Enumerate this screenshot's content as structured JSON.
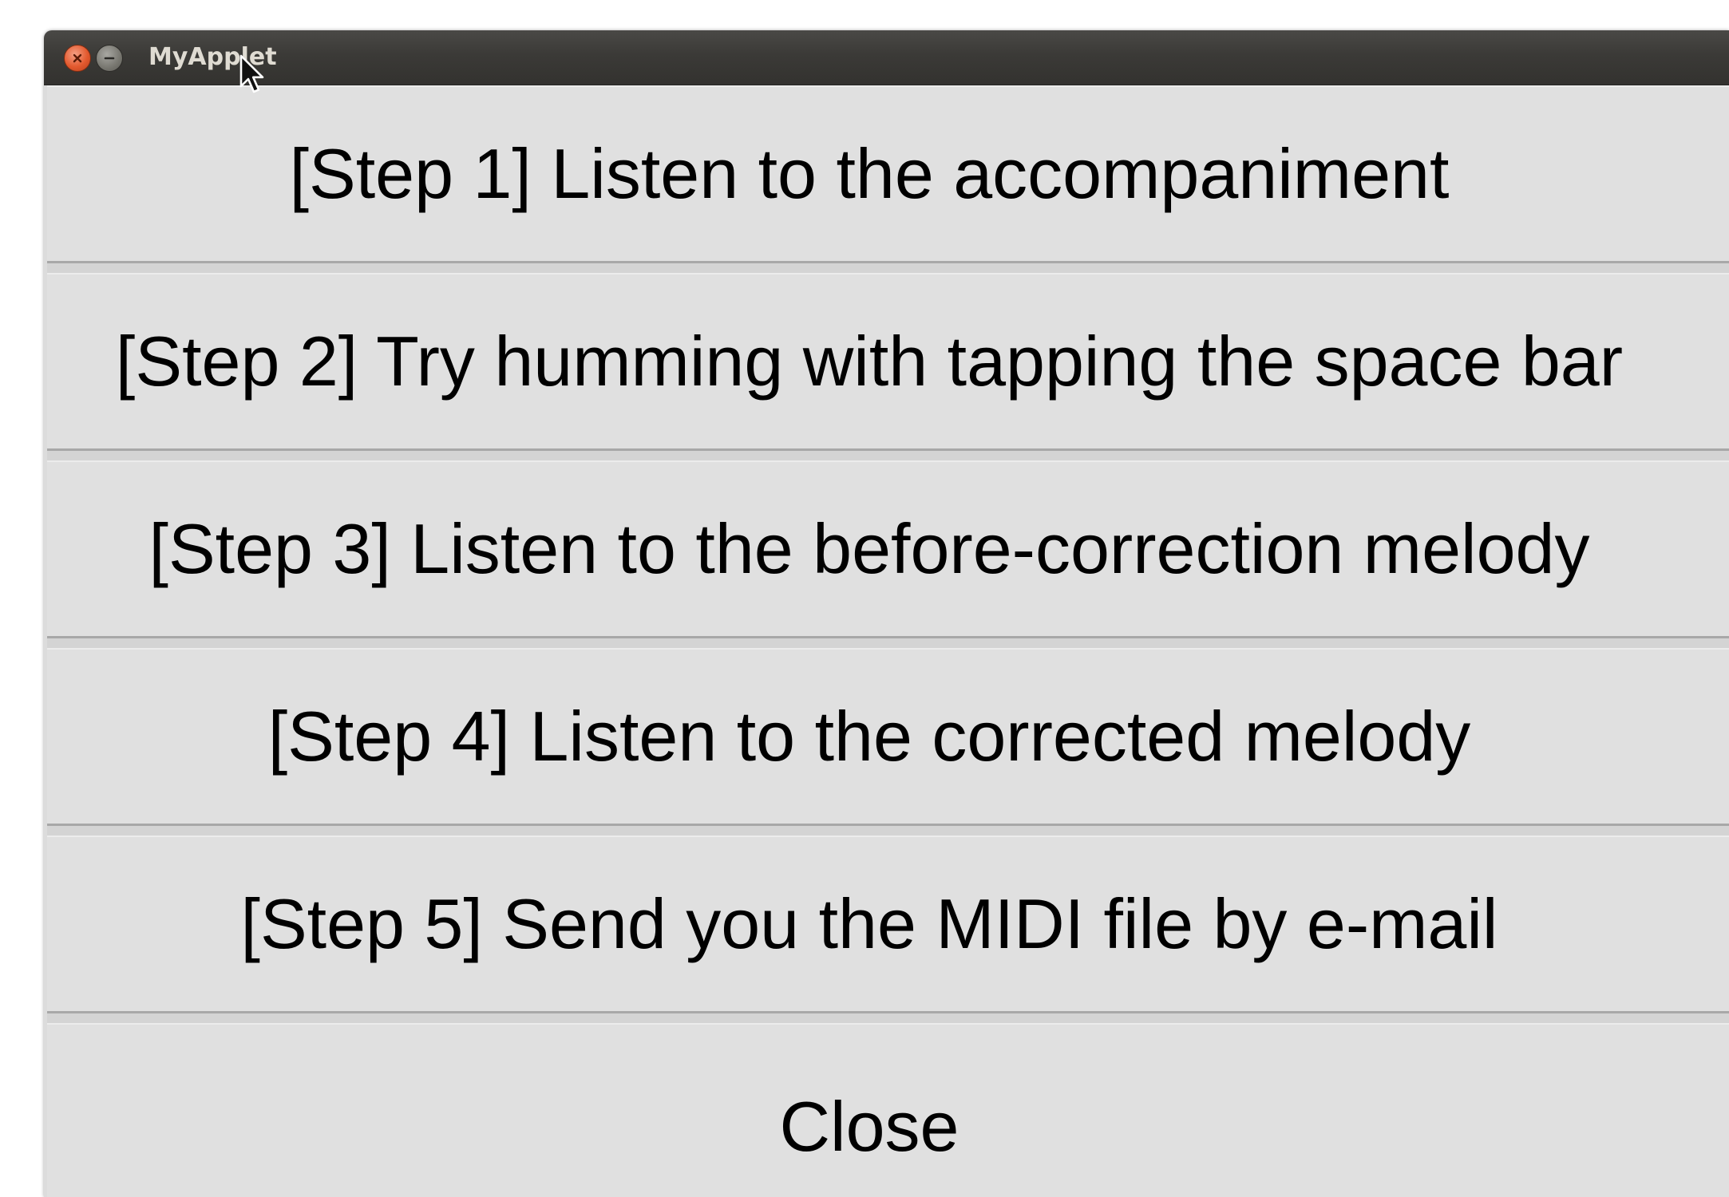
{
  "window": {
    "title": "MyApplet"
  },
  "buttons": [
    {
      "label": "[Step 1] Listen to the accompaniment"
    },
    {
      "label": "[Step 2] Try humming with tapping the space bar"
    },
    {
      "label": "[Step 3] Listen to the before-correction melody"
    },
    {
      "label": "[Step 4] Listen to the corrected melody"
    },
    {
      "label": "[Step 5] Send you the MIDI file by e-mail"
    },
    {
      "label": "Close"
    }
  ],
  "icons": {
    "close": "close-icon",
    "minimize": "minimize-icon",
    "cursor": "mouse-cursor-icon"
  },
  "colors": {
    "titlebar": "#3b3a37",
    "close_button": "#e3592e",
    "button_face": "#e0e0e0"
  }
}
